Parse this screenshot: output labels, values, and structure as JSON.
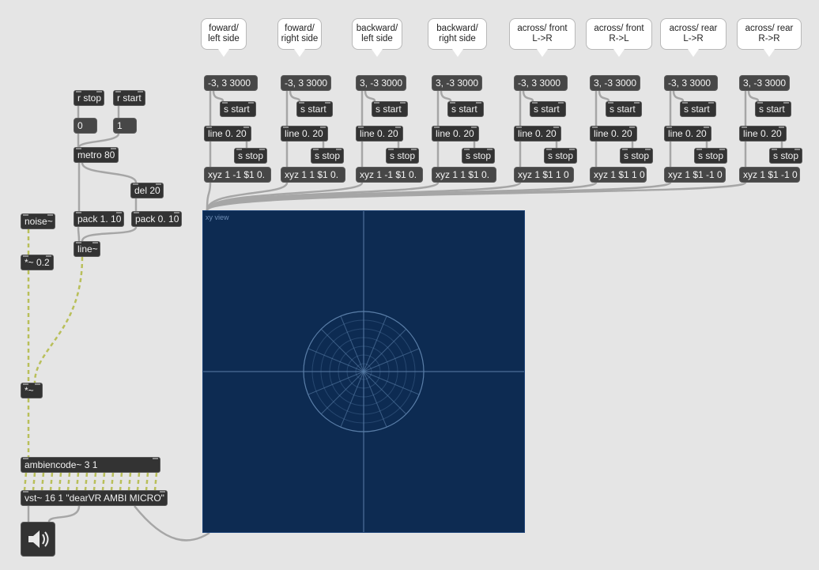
{
  "comments": [
    {
      "line1": "foward/",
      "line2": "left side"
    },
    {
      "line1": "foward/",
      "line2": "right side"
    },
    {
      "line1": "backward/",
      "line2": "left side"
    },
    {
      "line1": "backward/",
      "line2": "right side"
    },
    {
      "line1": "across/ front",
      "line2": "L->R"
    },
    {
      "line1": "across/ front",
      "line2": "R->L"
    },
    {
      "line1": "across/ rear",
      "line2": "L->R"
    },
    {
      "line1": "across/ rear",
      "line2": "R->R"
    }
  ],
  "columns": [
    {
      "msg": "-3, 3 3000",
      "xyz": "xyz 1 -1 $1 0."
    },
    {
      "msg": "-3, 3 3000",
      "xyz": "xyz 1 1 $1 0."
    },
    {
      "msg": "3, -3 3000",
      "xyz": "xyz 1 -1 $1 0."
    },
    {
      "msg": "3, -3 3000",
      "xyz": "xyz 1 1 $1 0."
    },
    {
      "msg": "-3, 3 3000",
      "xyz": "xyz 1 $1 1 0"
    },
    {
      "msg": "3, -3 3000",
      "xyz": "xyz 1 $1 1 0"
    },
    {
      "msg": "-3, 3 3000",
      "xyz": "xyz 1 $1 -1 0"
    },
    {
      "msg": "3, -3 3000",
      "xyz": "xyz 1 $1 -1 0"
    }
  ],
  "common": {
    "s_start": "s start",
    "line": "line 0. 20",
    "s_stop": "s stop"
  },
  "left": {
    "r_stop": "r stop",
    "r_start": "r start",
    "msg_0": "0",
    "msg_1": "1",
    "metro": "metro 80",
    "del": "del 20",
    "pack1": "pack 1. 10",
    "pack2": "pack 0. 10",
    "line": "line~",
    "noise": "noise~",
    "mult02": "*~ 0.2",
    "mult": "*~",
    "ambiencode": "ambiencode~ 3 1",
    "vst": "vst~ 16 1 \"dearVR AMBI MICRO\""
  },
  "xyview": {
    "label": "xy view",
    "background": "#0d2b52",
    "grid_color": "#5a7ea8"
  },
  "colors": {
    "canvas": "#e5e5e5",
    "object": "#333333",
    "message": "#474747",
    "signal_patch": "#c8d24a"
  },
  "icons": {
    "dac": "speaker-icon"
  }
}
